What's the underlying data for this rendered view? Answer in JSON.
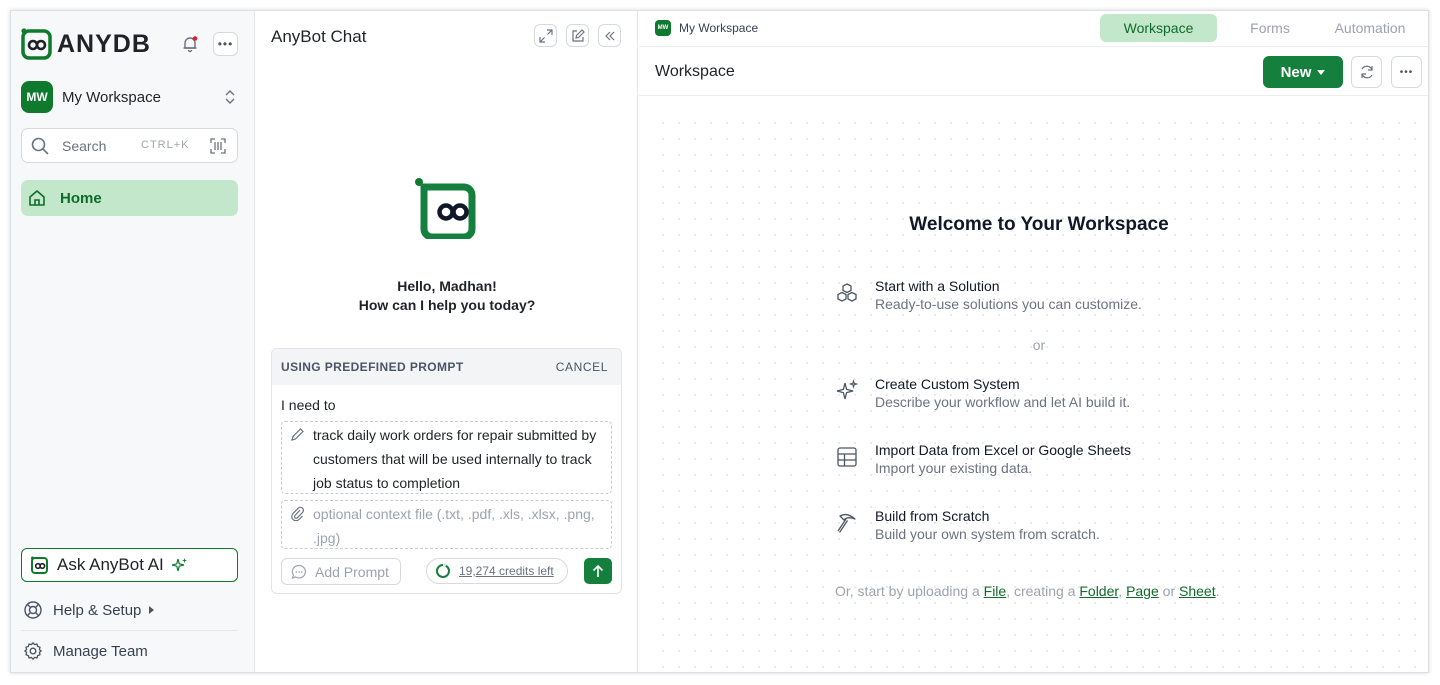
{
  "brand": {
    "name": "ANYDB",
    "green": "#0f7a2e",
    "light_green": "#c2e7ca"
  },
  "sidebar": {
    "workspace_initials": "MW",
    "workspace_name": "My Workspace",
    "search": {
      "label": "Search",
      "shortcut": "CTRL+K"
    },
    "nav": [
      {
        "label": "Home",
        "icon": "home-icon",
        "active": true
      }
    ],
    "ask_bot": "Ask AnyBot AI",
    "help": "Help & Setup",
    "manage_team": "Manage Team"
  },
  "chat": {
    "title": "AnyBot Chat",
    "greeting_line1": "Hello, Madhan!",
    "greeting_line2": "How can I help you today?",
    "prompt_card": {
      "header": "USING PREDEFINED PROMPT",
      "cancel": "CANCEL",
      "intro": "I need to",
      "task_text": "track daily work orders for repair submitted by customers that will be used internally to track job status to completion",
      "context_placeholder": "optional context file (.txt, .pdf, .xls, .xlsx, .png, .jpg)",
      "add_prompt": "Add Prompt",
      "credits": "19,274 credits left"
    }
  },
  "main": {
    "topbar": {
      "badge": "MW",
      "workspace": "My Workspace"
    },
    "tabs": [
      {
        "label": "Workspace",
        "active": true
      },
      {
        "label": "Forms",
        "active": false
      },
      {
        "label": "Automation",
        "active": false
      }
    ],
    "title": "Workspace",
    "new_button": "New",
    "welcome": "Welcome to Your Workspace",
    "options": [
      {
        "title": "Start with a Solution",
        "subtitle": "Ready-to-use solutions you can customize.",
        "icon": "cubes-icon"
      },
      {
        "title": "Create Custom System",
        "subtitle": "Describe your workflow and let AI build it.",
        "icon": "sparkle-icon"
      },
      {
        "title": "Import Data from Excel or Google Sheets",
        "subtitle": "Import your existing data.",
        "icon": "table-icon"
      },
      {
        "title": "Build from Scratch",
        "subtitle": "Build your own system from scratch.",
        "icon": "pickaxe-icon"
      }
    ],
    "or": "or",
    "footer": {
      "prefix": "Or, start by uploading a ",
      "file": "File",
      "mid1": ", creating a ",
      "folder": "Folder",
      "comma": ", ",
      "page": "Page",
      "or_word": " or ",
      "sheet": "Sheet",
      "end": "."
    }
  }
}
